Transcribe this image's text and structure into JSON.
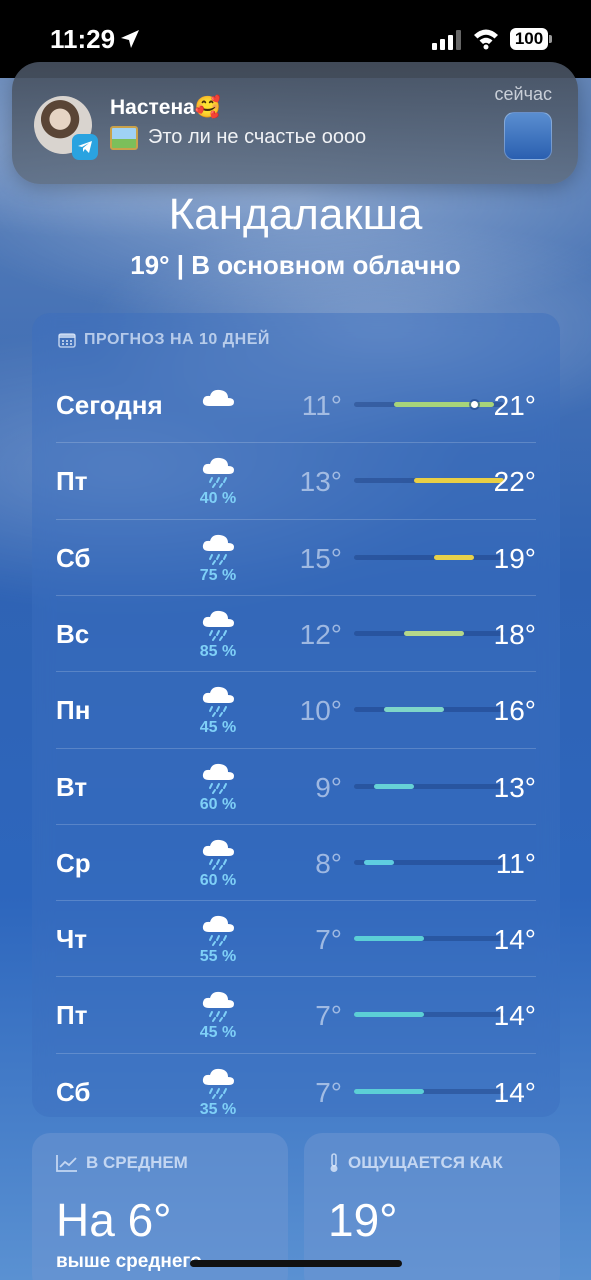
{
  "status": {
    "time": "11:29",
    "battery": "100"
  },
  "notification": {
    "sender": "Настена🥰",
    "message": "Это ли не счастье оооо",
    "time": "сейчас"
  },
  "location": {
    "city": "Кандалакша",
    "summary": "19°  |  В основном облачно"
  },
  "forecast": {
    "header": "ПРОГНОЗ НА 10 ДНЕЙ",
    "scale_min": 7,
    "scale_max": 22,
    "days": [
      {
        "day": "Сегодня",
        "icon": "cloud-icon",
        "precip": "",
        "low": "11°",
        "high": "21°",
        "low_v": 11,
        "high_v": 21,
        "current_v": 19,
        "color": "#a7d47a"
      },
      {
        "day": "Пт",
        "icon": "cloud-rain-icon",
        "precip": "40 %",
        "low": "13°",
        "high": "22°",
        "low_v": 13,
        "high_v": 22,
        "color": "#e9cf45"
      },
      {
        "day": "Сб",
        "icon": "cloud-rain-icon",
        "precip": "75 %",
        "low": "15°",
        "high": "19°",
        "low_v": 15,
        "high_v": 19,
        "color": "#e7d14a"
      },
      {
        "day": "Вс",
        "icon": "cloud-rain-icon",
        "precip": "85 %",
        "low": "12°",
        "high": "18°",
        "low_v": 12,
        "high_v": 18,
        "color": "#b5d88a"
      },
      {
        "day": "Пн",
        "icon": "cloud-rain-icon",
        "precip": "45 %",
        "low": "10°",
        "high": "16°",
        "low_v": 10,
        "high_v": 16,
        "color": "#7fd6c8"
      },
      {
        "day": "Вт",
        "icon": "cloud-rain-icon",
        "precip": "60 %",
        "low": "9°",
        "high": "13°",
        "low_v": 9,
        "high_v": 13,
        "color": "#66d1d6"
      },
      {
        "day": "Ср",
        "icon": "cloud-rain-icon",
        "precip": "60 %",
        "low": "8°",
        "high": "11°",
        "low_v": 8,
        "high_v": 11,
        "color": "#5fcde0"
      },
      {
        "day": "Чт",
        "icon": "cloud-rain-icon",
        "precip": "55 %",
        "low": "7°",
        "high": "14°",
        "low_v": 7,
        "high_v": 14,
        "color": "#5ccfd6"
      },
      {
        "day": "Пт",
        "icon": "cloud-rain-icon",
        "precip": "45 %",
        "low": "7°",
        "high": "14°",
        "low_v": 7,
        "high_v": 14,
        "color": "#5ccfd6"
      },
      {
        "day": "Сб",
        "icon": "cloud-rain-icon",
        "precip": "35 %",
        "low": "7°",
        "high": "14°",
        "low_v": 7,
        "high_v": 14,
        "color": "#5ccfd6"
      }
    ]
  },
  "average_card": {
    "title": "В СРЕДНЕМ",
    "value": "На 6°",
    "sub": "выше среднего"
  },
  "feels_like_card": {
    "title": "ОЩУЩАЕТСЯ КАК",
    "value": "19°"
  }
}
